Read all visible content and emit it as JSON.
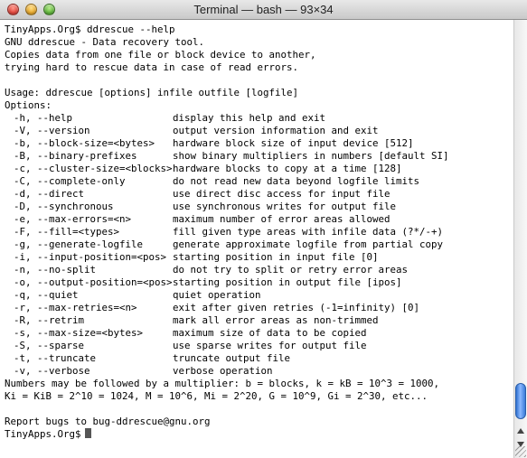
{
  "window": {
    "title": "Terminal — bash — 93×34"
  },
  "prompt": "TinyApps.Org$",
  "command": "ddrescue --help",
  "intro": [
    "GNU ddrescue - Data recovery tool.",
    "Copies data from one file or block device to another,",
    "trying hard to rescue data in case of read errors."
  ],
  "usage": "Usage: ddrescue [options] infile outfile [logfile]",
  "options_header": "Options:",
  "options": [
    {
      "opt": "-h, --help",
      "desc": "display this help and exit"
    },
    {
      "opt": "-V, --version",
      "desc": "output version information and exit"
    },
    {
      "opt": "-b, --block-size=<bytes>",
      "desc": "hardware block size of input device [512]"
    },
    {
      "opt": "-B, --binary-prefixes",
      "desc": "show binary multipliers in numbers [default SI]"
    },
    {
      "opt": "-c, --cluster-size=<blocks>",
      "desc": "hardware blocks to copy at a time [128]"
    },
    {
      "opt": "-C, --complete-only",
      "desc": "do not read new data beyond logfile limits"
    },
    {
      "opt": "-d, --direct",
      "desc": "use direct disc access for input file"
    },
    {
      "opt": "-D, --synchronous",
      "desc": "use synchronous writes for output file"
    },
    {
      "opt": "-e, --max-errors=<n>",
      "desc": "maximum number of error areas allowed"
    },
    {
      "opt": "-F, --fill=<types>",
      "desc": "fill given type areas with infile data (?*/-+)"
    },
    {
      "opt": "-g, --generate-logfile",
      "desc": "generate approximate logfile from partial copy"
    },
    {
      "opt": "-i, --input-position=<pos>",
      "desc": "starting position in input file [0]"
    },
    {
      "opt": "-n, --no-split",
      "desc": "do not try to split or retry error areas"
    },
    {
      "opt": "-o, --output-position=<pos>",
      "desc": "starting position in output file [ipos]"
    },
    {
      "opt": "-q, --quiet",
      "desc": "quiet operation"
    },
    {
      "opt": "-r, --max-retries=<n>",
      "desc": "exit after given retries (-1=infinity) [0]"
    },
    {
      "opt": "-R, --retrim",
      "desc": "mark all error areas as non-trimmed"
    },
    {
      "opt": "-s, --max-size=<bytes>",
      "desc": "maximum size of data to be copied"
    },
    {
      "opt": "-S, --sparse",
      "desc": "use sparse writes for output file"
    },
    {
      "opt": "-t, --truncate",
      "desc": "truncate output file"
    },
    {
      "opt": "-v, --verbose",
      "desc": "verbose operation"
    }
  ],
  "multiplier": [
    "Numbers may be followed by a multiplier: b = blocks, k = kB = 10^3 = 1000,",
    "Ki = KiB = 2^10 = 1024, M = 10^6, Mi = 2^20, G = 10^9, Gi = 2^30, etc..."
  ],
  "report": "Report bugs to bug-ddrescue@gnu.org",
  "colors": {
    "scroll_thumb": "#3a7bd8",
    "close": "#e0453a",
    "minimize": "#e7a72a",
    "maximize": "#5fb53a"
  }
}
